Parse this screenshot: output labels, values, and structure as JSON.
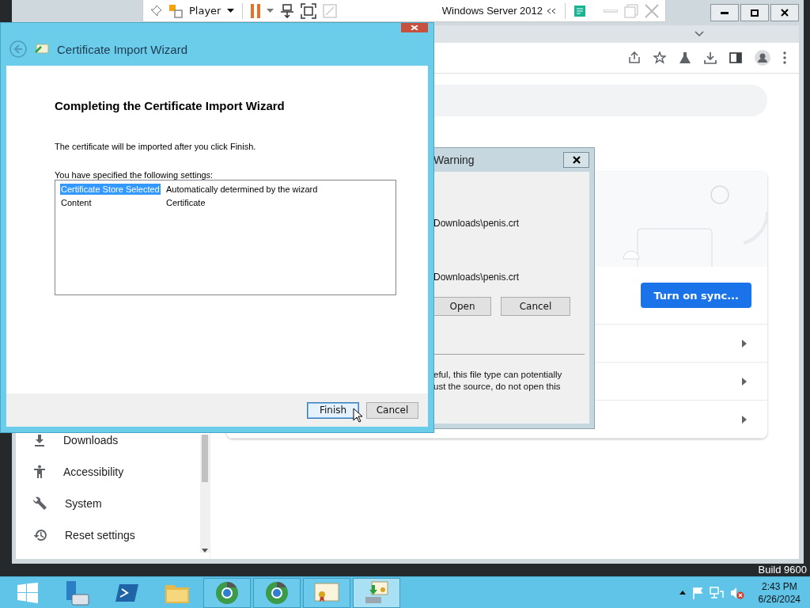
{
  "vm_toolbar": {
    "menu_label": "Player",
    "vm_name": "Windows Server 2012"
  },
  "browser": {
    "sidebar_items": [
      {
        "label": "Downloads",
        "kind": "download"
      },
      {
        "label": "Accessibility",
        "kind": "accessibility"
      },
      {
        "label": "System",
        "kind": "wrench"
      },
      {
        "label": "Reset settings",
        "kind": "history"
      }
    ],
    "sync_button": "Turn on sync..."
  },
  "security_dialog": {
    "title": "Warning",
    "path_lines": [
      "Downloads\\penis.crt",
      "Downloads\\penis.crt"
    ],
    "buttons": [
      "Open",
      "Cancel"
    ],
    "warning_lines": [
      "eful, this file type can potentially",
      "ust the source, do not open this"
    ]
  },
  "wizard": {
    "title": "Certificate Import Wizard",
    "heading": "Completing the Certificate Import Wizard",
    "intro": "The certificate will be imported after you click Finish.",
    "settings_label": "You have specified the following settings:",
    "settings": [
      {
        "name": "Certificate Store Selected",
        "value": "Automatically determined by the wizard",
        "selected": true
      },
      {
        "name": "Content",
        "value": "Certificate",
        "selected": false
      }
    ],
    "buttons": [
      {
        "label": "Finish",
        "focused": true
      },
      {
        "label": "Cancel",
        "focused": false
      }
    ]
  },
  "desktop_watermark": "Build 9600",
  "taskbar": {
    "apps": [
      {
        "kind": "start",
        "running": false,
        "selected": false
      },
      {
        "kind": "server",
        "running": false,
        "selected": false
      },
      {
        "kind": "powershell",
        "running": false,
        "selected": false
      },
      {
        "kind": "explorer",
        "running": false,
        "selected": false
      },
      {
        "kind": "chrome",
        "running": true,
        "selected": false
      },
      {
        "kind": "chrome",
        "running": true,
        "selected": false
      },
      {
        "kind": "certificate",
        "running": true,
        "selected": false
      },
      {
        "kind": "cert-import",
        "running": true,
        "selected": true
      }
    ],
    "time": "2:43 PM",
    "date": "6/26/2024"
  }
}
